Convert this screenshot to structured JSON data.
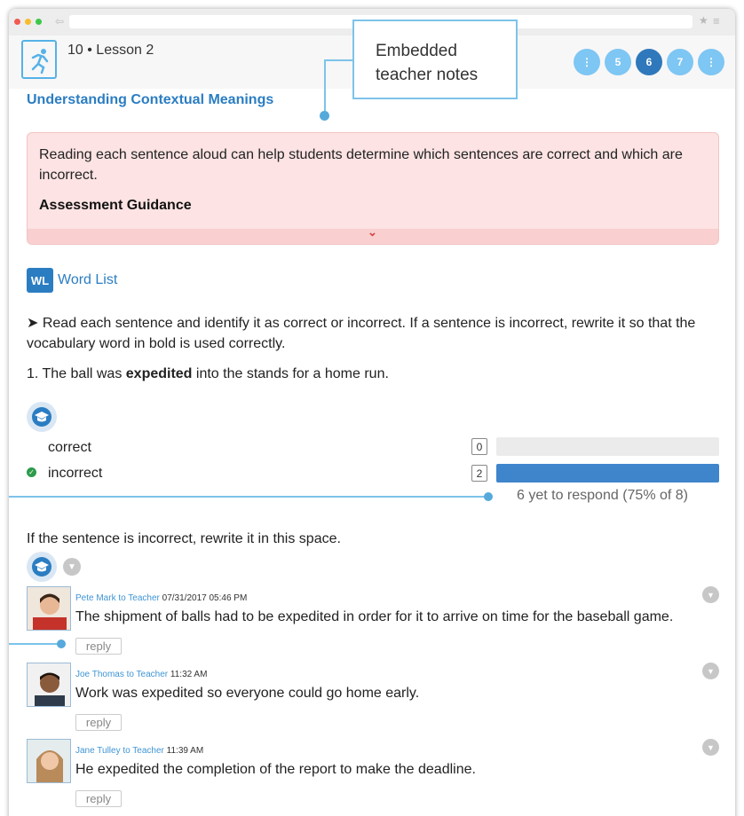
{
  "colors": {
    "accent_blue": "#2b7dc2",
    "bar_blue": "#3f85cc",
    "note_bg": "#fde3e3",
    "correct_green": "#2d9b4b",
    "callout_border": "#7dc3ea"
  },
  "lesson": {
    "title": "10 • Lesson 2",
    "icon": "runner-icon"
  },
  "pagination": {
    "items": [
      {
        "label": "⋮",
        "color": "#7ec6f3"
      },
      {
        "label": "5",
        "color": "#7ec6f3"
      },
      {
        "label": "6",
        "color": "#2f78bb"
      },
      {
        "label": "7",
        "color": "#7ec6f3"
      },
      {
        "label": "⋮",
        "color": "#7ec6f3"
      }
    ]
  },
  "callout": {
    "text": "Embedded\nteacher notes"
  },
  "section": {
    "title": "Understanding Contextual Meanings"
  },
  "teacher_note": {
    "text": "Reading each sentence aloud can help students determine which sentences are correct and which are incorrect.",
    "heading": "Assessment Guidance",
    "expand_icon": "chevron-down-icon"
  },
  "word_list": {
    "badge": "WL",
    "label": "Word List"
  },
  "instruction": {
    "text": "➤ Read each sentence and identify it as correct or incorrect. If a sentence is incorrect, rewrite it so that the vocabulary word in bold is used correctly."
  },
  "question": {
    "number_prefix": "1. The ball was ",
    "bold_word": "expedited",
    "suffix": " into the stands for a home run."
  },
  "answers": {
    "options": [
      {
        "label": "correct",
        "count": "0",
        "fill_fraction": 0.0,
        "is_correct": false
      },
      {
        "label": "incorrect",
        "count": "2",
        "fill_fraction": 1.0,
        "is_correct": true
      }
    ],
    "yet_to_respond": "6 yet to respond (75% of 8)"
  },
  "rewrite": {
    "label": "If the sentence is incorrect, rewrite it in this space.",
    "responses": [
      {
        "author": "Pete Mark to Teacher",
        "time": "07/31/2017 05:46 PM",
        "text": "The shipment of balls had to be expedited in order for it to arrive on time for the baseball game.",
        "reply_label": "reply"
      },
      {
        "author": "Joe Thomas to Teacher",
        "time": "11:32 AM",
        "text": "Work was expedited so everyone could go home early.",
        "reply_label": "reply"
      },
      {
        "author": "Jane Tulley to Teacher",
        "time": "11:39 AM",
        "text": "He expedited the completion of the report to make the deadline.",
        "reply_label": "reply"
      }
    ]
  }
}
